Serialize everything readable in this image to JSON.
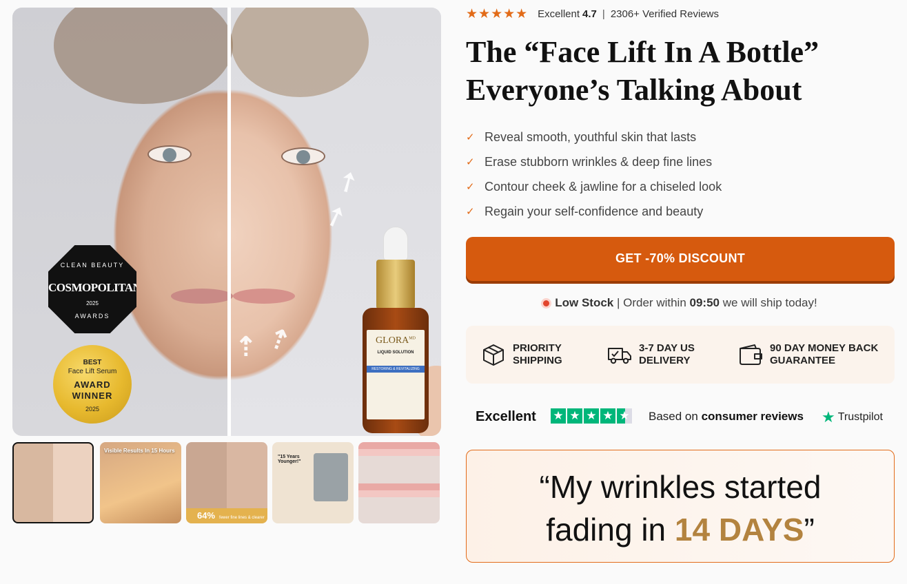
{
  "rating": {
    "stars": "★★★★★",
    "label": "Excellent",
    "score": "4.7",
    "separator": "|",
    "reviews": "2306+ Verified Reviews"
  },
  "headline": {
    "line1": "The “Face Lift In A Bottle”",
    "line2": "Everyone’s Talking About"
  },
  "benefits": [
    "Reveal smooth, youthful skin that lasts",
    "Erase stubborn wrinkles & deep fine lines",
    "Contour cheek & jawline for a chiseled look",
    "Regain your self-confidence and beauty"
  ],
  "cta": {
    "label": "GET -70% DISCOUNT"
  },
  "stock": {
    "low_stock": "Low Stock",
    "separator": "|",
    "order_within": "Order within",
    "time": "09:50",
    "ship_text": "we will ship today!"
  },
  "features": [
    {
      "icon": "box-icon",
      "line1": "PRIORITY",
      "line2": "SHIPPING"
    },
    {
      "icon": "truck-icon",
      "line1": "3-7 DAY US",
      "line2": "DELIVERY"
    },
    {
      "icon": "wallet-icon",
      "line1": "90 DAY MONEY BACK",
      "line2": "GUARANTEE"
    }
  ],
  "trust": {
    "excellent": "Excellent",
    "based_on": "Based on",
    "consumer_reviews": "consumer reviews",
    "logo": "Trustpilot"
  },
  "quote": {
    "line1": "“My wrinkles started",
    "line2_prefix": "fading in",
    "highlight": "14 DAYS",
    "close": "”"
  },
  "gallery": {
    "cosmo_badge": {
      "top": "CLEAN BEAUTY",
      "brand": "COSMOPOLITAN",
      "year": "2025",
      "bottom": "AWARDS"
    },
    "award_badge": {
      "best": "BEST",
      "category": "Face Lift Serum",
      "award": "AWARD",
      "winner": "WINNER",
      "year": "2025"
    },
    "bottle": {
      "brand": "GLORA",
      "sup": "MD",
      "product": "LIQUID SOLUTION",
      "band": "RESTORING & REVITALIZING"
    },
    "thumbs": {
      "t2_caption": "Visible Results In 15 Hours",
      "t3_stat": "64%",
      "t3_caption": "fewer fine lines & clearer skin",
      "t4_quote": "\"15 Years Younger!\""
    }
  },
  "colors": {
    "accent": "#d65a0e",
    "star": "#e26b18",
    "trustpilot": "#00b67a",
    "highlight": "#b3833f"
  }
}
